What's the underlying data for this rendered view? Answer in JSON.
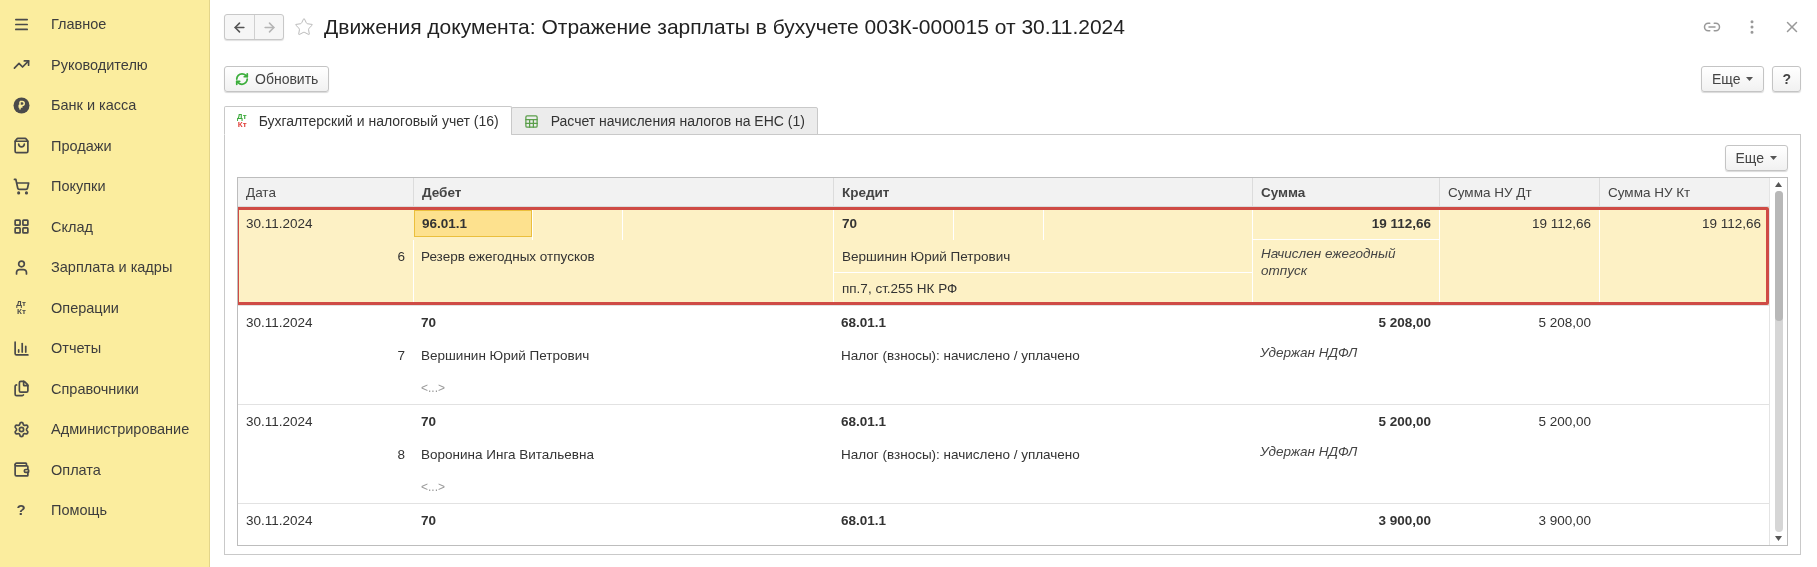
{
  "sidebar": {
    "items": [
      {
        "label": "Главное",
        "selected": false
      },
      {
        "label": "Руководителю",
        "selected": false
      },
      {
        "label": "Банк и касса",
        "selected": false
      },
      {
        "label": "Продажи",
        "selected": false
      },
      {
        "label": "Покупки",
        "selected": false
      },
      {
        "label": "Склад",
        "selected": false
      },
      {
        "label": "Зарплата и кадры",
        "selected": false
      },
      {
        "label": "Операции",
        "selected": false,
        "icon_text": [
          "Дт",
          "Кт"
        ]
      },
      {
        "label": "Отчеты",
        "selected": false
      },
      {
        "label": "Справочники",
        "selected": false
      },
      {
        "label": "Администрирование",
        "selected": false
      },
      {
        "label": "Оплата",
        "selected": false
      },
      {
        "label": "Помощь",
        "selected": false,
        "icon_text": [
          "?"
        ]
      }
    ]
  },
  "window": {
    "title": "Движения документа: Отражение зарплаты в бухучете 003К-000015 от 30.11.2024",
    "back_disabled": false,
    "forward_disabled": true,
    "favorite": false
  },
  "toolbar": {
    "refresh": "Обновить",
    "more": "Еще",
    "help": "?"
  },
  "tabs": [
    {
      "label": "Бухгалтерский и налоговый учет (16)",
      "selected": true,
      "icon_text": [
        "Дт",
        "Кт"
      ]
    },
    {
      "label": "Расчет начисления налогов на ЕНС (1)",
      "selected": false
    }
  ],
  "table": {
    "more": "Еще",
    "columns": [
      {
        "label": "Дата",
        "bold": false
      },
      {
        "label": "Дебет",
        "bold": true
      },
      {
        "label": "Кредит",
        "bold": true
      },
      {
        "label": "Сумма",
        "bold": true
      },
      {
        "label": "Сумма НУ Дт",
        "bold": false
      },
      {
        "label": "Сумма НУ Кт",
        "bold": false
      }
    ],
    "rows": [
      {
        "selected": true,
        "outlined": true,
        "date": "30.11.2024",
        "number": "6",
        "debit": "96.01.1",
        "debit_details": [
          "Резерв ежегодных отпусков"
        ],
        "credit": "70",
        "credit_details": [
          "Вершинин Юрий Петрович",
          "пп.7, ст.255 НК РФ"
        ],
        "sum": "19 112,66",
        "note": "Начислен ежегодный отпуск",
        "sum_nu_dt": "19 112,66",
        "sum_nu_kt": "19 112,66"
      },
      {
        "selected": false,
        "outlined": false,
        "date": "30.11.2024",
        "number": "7",
        "debit": "70",
        "debit_details": [
          "Вершинин Юрий Петрович",
          "<...>"
        ],
        "credit": "68.01.1",
        "credit_details": [
          "Налог (взносы): начислено / уплачено"
        ],
        "sum": "5 208,00",
        "note": "Удержан НДФЛ",
        "sum_nu_dt": "5 208,00"
      },
      {
        "selected": false,
        "outlined": false,
        "date": "30.11.2024",
        "number": "8",
        "debit": "70",
        "debit_details": [
          "Воронина Инга Витальевна",
          "<...>"
        ],
        "credit": "68.01.1",
        "credit_details": [
          "Налог (взносы): начислено / уплачено"
        ],
        "sum": "5 200,00",
        "note": "Удержан НДФЛ",
        "sum_nu_dt": "5 200,00"
      },
      {
        "selected": false,
        "outlined": false,
        "date": "30.11.2024",
        "debit": "70",
        "credit": "68.01.1",
        "sum": "3 900,00",
        "sum_nu_dt": "3 900,00"
      }
    ]
  }
}
